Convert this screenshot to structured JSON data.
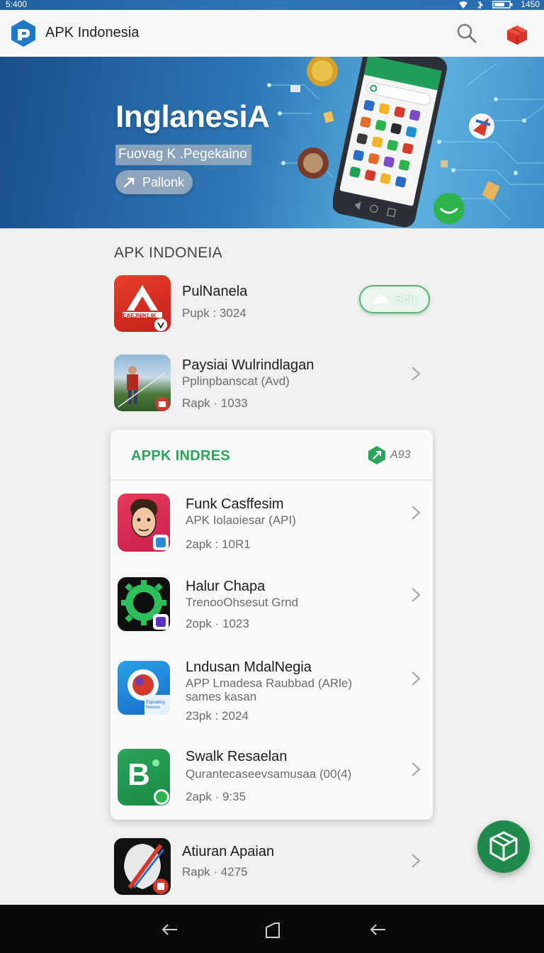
{
  "status_bar": {
    "time": "5:400",
    "right_text": "1450"
  },
  "app_bar": {
    "title": "APK Indonesia"
  },
  "banner": {
    "title": "InglanesiA",
    "subtitle": "Fuovag K .Pegekaino",
    "button_label": "Pallonk",
    "phone_search": "Gesach",
    "phone_app_title": "Aiaka"
  },
  "section": {
    "heading": "APK INDONEIA"
  },
  "top_apps": [
    {
      "name": "PulNanela",
      "meta": "Pupk : 3024",
      "action_label": "Sph",
      "icon_text": "EAEJNIKLIK"
    },
    {
      "name": "Paysiai Wulrindlagan",
      "subtitle": "Pplinpbanscat (Avd)",
      "meta": "Rapk · 1033"
    }
  ],
  "card": {
    "title": "APPK INDRES",
    "badge": "A93",
    "apps": [
      {
        "name": "Funk Casffesim",
        "subtitle": "APK Iolaoiesar (API)",
        "meta": "2apk : 10R1"
      },
      {
        "name": "Halur Chapa",
        "subtitle": "TrenooOhsesut Grnd",
        "meta": "2opk · 1023"
      },
      {
        "name": "Lndusan MdalNegia",
        "subtitle": "APP Lmadesa Raubbad (ARle)",
        "subtitle2": "sames kasan",
        "meta": "23pk : 2024",
        "icon_text": "Expuating Resses"
      },
      {
        "name": "Swalk Resaelan",
        "subtitle": "Qurantecaseevsamusaa (00(4)",
        "meta": "2apk · 9:35",
        "icon_text": "B"
      }
    ]
  },
  "bottom_app": {
    "name": "Atiuran Apaian",
    "meta": "Rapk · 4275"
  },
  "colors": {
    "accent_green": "#2aa55a",
    "fab": "#1f8a4a",
    "banner_blue": "#2d78b8"
  }
}
